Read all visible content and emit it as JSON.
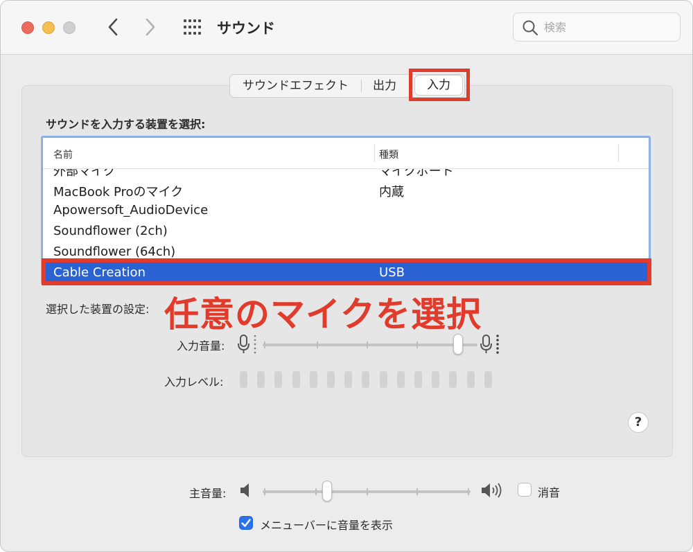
{
  "window": {
    "title": "サウンド",
    "search": {
      "placeholder": "検索",
      "value": ""
    }
  },
  "tabs": [
    {
      "label": "サウンドエフェクト",
      "active": false
    },
    {
      "label": "出力",
      "active": false
    },
    {
      "label": "入力",
      "active": true
    }
  ],
  "input": {
    "section_label": "サウンドを入力する装置を選択:",
    "columns": [
      "名前",
      "種類"
    ],
    "devices": [
      {
        "name": "外部マイク",
        "type": "マイクポート"
      },
      {
        "name": "MacBook Proのマイク",
        "type": "内蔵"
      },
      {
        "name": "Apowersoft_AudioDevice",
        "type": ""
      },
      {
        "name": "Soundflower (2ch)",
        "type": ""
      },
      {
        "name": "Soundflower (64ch)",
        "type": ""
      },
      {
        "name": "Cable Creation",
        "type": "USB",
        "selected": true
      }
    ],
    "settings_label": "選択した装置の設定:",
    "volume_label": "入力音量:",
    "volume_level": 0.93,
    "level_label": "入力レベル:",
    "level_segments": 15,
    "level_active": 0
  },
  "annotation": "任意のマイクを選択",
  "help_label": "?",
  "output": {
    "main_volume_label": "主音量:",
    "main_volume_level": 0.3,
    "mute_label": "消音",
    "mute_checked": false,
    "show_in_menubar_label": "メニューバーに音量を表示",
    "show_in_menubar_checked": true
  },
  "colors": {
    "accent": "#2a62d4",
    "annotation_red": "#e13b2b",
    "close": "#ed6a5e",
    "minimize": "#f5bf4f",
    "maximize": "#cfcfcf"
  }
}
